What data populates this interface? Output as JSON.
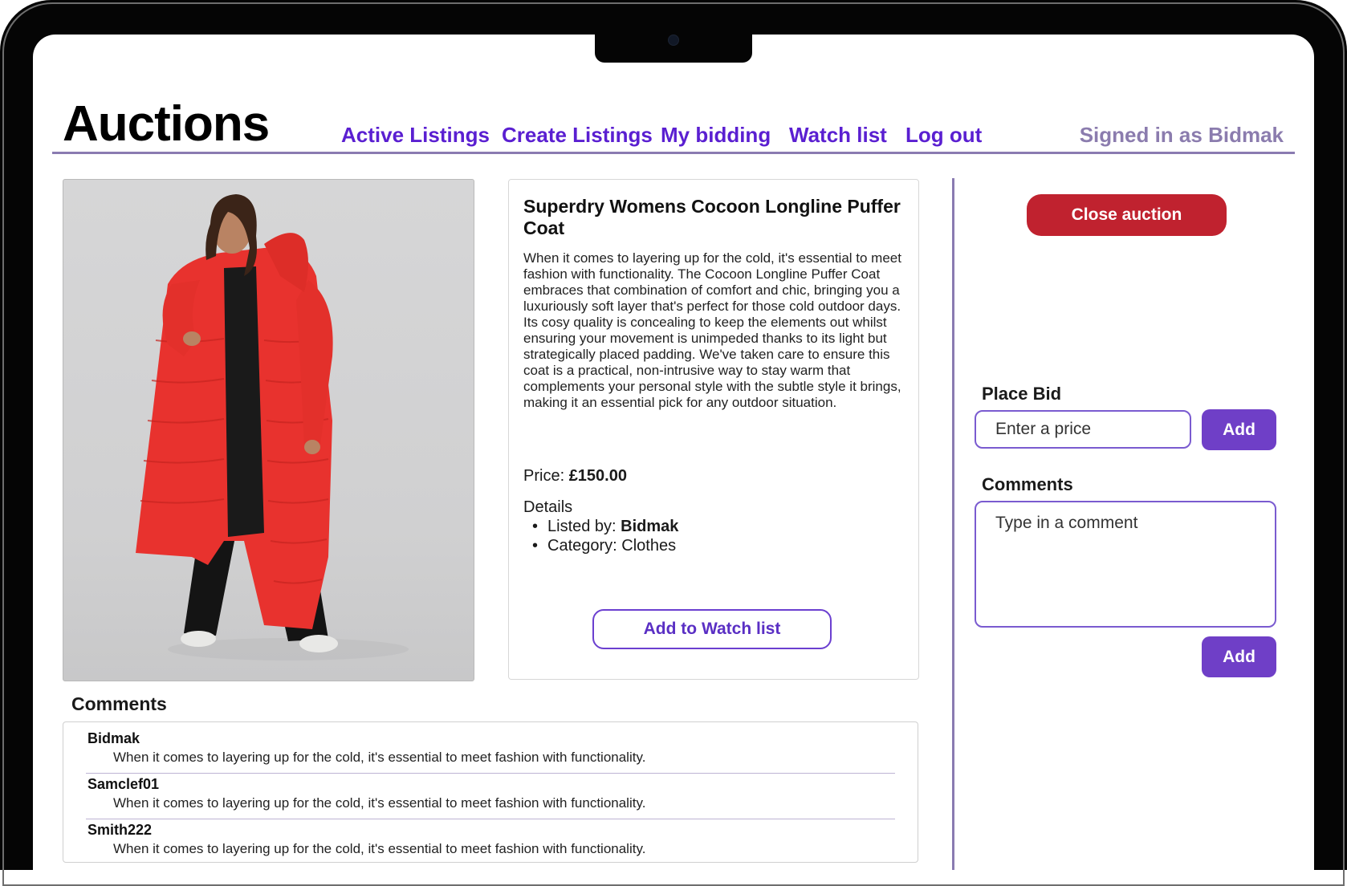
{
  "app": {
    "title": "Auctions"
  },
  "nav": {
    "active_listings": "Active Listings",
    "create_listings": "Create Listings",
    "my_bidding": "My bidding",
    "watch_list": "Watch list",
    "log_out": "Log out",
    "signed_in_prefix": "Signed in as",
    "username": "Bidmak"
  },
  "product": {
    "title": "Superdry Womens Cocoon Longline Puffer Coat",
    "description": "When it comes to layering up for the cold, it's essential to meet fashion with functionality. The Cocoon Longline Puffer Coat embraces that combination of comfort and chic, bringing you a luxuriously soft layer that's perfect for those cold outdoor days. Its cosy quality is concealing to keep the elements out whilst ensuring your movement is unimpeded thanks to its light but strategically placed padding. We've taken care to ensure this coat is a practical, non-intrusive way to stay warm that complements your personal style with the subtle style it brings, making it an essential pick for any outdoor situation.",
    "price_label": "Price:",
    "price_value": "£150.00",
    "details_heading": "Details",
    "listed_by_label": "Listed by:",
    "listed_by_value": "Bidmak",
    "category_label": "Category:",
    "category_value": "Clothes",
    "watch_button": "Add to Watch list"
  },
  "actions": {
    "close_auction": "Close auction",
    "place_bid_label": "Place Bid",
    "bid_placeholder": "Enter a price",
    "bid_add": "Add",
    "comments_label": "Comments",
    "comment_placeholder": "Type in a comment",
    "comment_add": "Add"
  },
  "comments": {
    "heading": "Comments",
    "items": [
      {
        "user": "Bidmak",
        "text": "When it comes to layering up for the cold, it's essential to meet fashion with functionality."
      },
      {
        "user": "Samclef01",
        "text": "When it comes to layering up for the cold, it's essential to meet fashion with functionality."
      },
      {
        "user": "Smith222",
        "text": "When it comes to layering up for the cold, it's essential to meet fashion with functionality."
      }
    ]
  },
  "colors": {
    "accent": "#5a1fd1",
    "button_purple": "#6f3fc7",
    "close_red": "#c0222f",
    "coat_red": "#e8322e",
    "divider": "#8a7bb1"
  }
}
